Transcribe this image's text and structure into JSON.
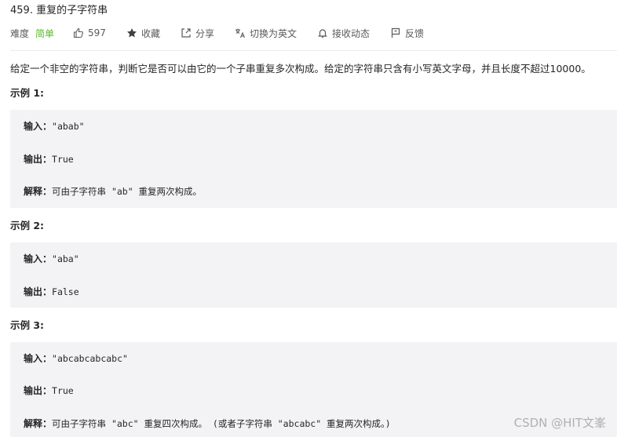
{
  "problem": {
    "title": "459. 重复的子字符串",
    "difficulty_label": "难度",
    "difficulty_value": "简单",
    "colors": {
      "easy": "#5ab726",
      "code_bg": "#f3f3f5"
    }
  },
  "toolbar": {
    "like_count": "597",
    "favorite_label": "收藏",
    "share_label": "分享",
    "translate_label": "切换为英文",
    "notify_label": "接收动态",
    "feedback_label": "反馈",
    "icons": [
      "thumbs-up-icon",
      "star-icon",
      "share-icon",
      "translate-icon",
      "bell-icon",
      "flag-icon"
    ]
  },
  "description": "给定一个非空的字符串，判断它是否可以由它的一个子串重复多次构成。给定的字符串只含有小写英文字母，并且长度不超过10000。",
  "examples": [
    {
      "heading": "示例 1:",
      "input_label": "输入：",
      "input_value": "\"abab\"",
      "output_label": "输出：",
      "output_value": "True",
      "explain_label": "解释：",
      "explain_value": "可由子字符串 \"ab\" 重复两次构成。"
    },
    {
      "heading": "示例 2:",
      "input_label": "输入：",
      "input_value": "\"aba\"",
      "output_label": "输出：",
      "output_value": "False"
    },
    {
      "heading": "示例 3:",
      "input_label": "输入：",
      "input_value": "\"abcabcabcabc\"",
      "output_label": "输出：",
      "output_value": "True",
      "explain_label": "解释：",
      "explain_value": "可由子字符串 \"abc\" 重复四次构成。 (或者子字符串 \"abcabc\" 重复两次构成。)"
    }
  ],
  "watermark": "CSDN @HIT文峯"
}
